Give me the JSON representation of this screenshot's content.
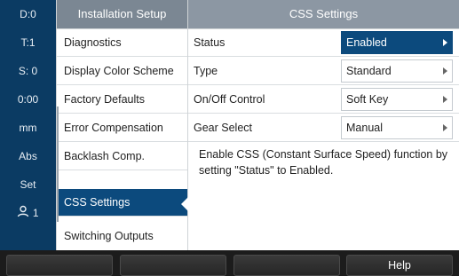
{
  "statusbar": {
    "items": [
      {
        "label": "D:0"
      },
      {
        "label": "T:1"
      },
      {
        "label": "S: 0"
      },
      {
        "label": "0:00"
      },
      {
        "label": "mm"
      },
      {
        "label": "Abs"
      },
      {
        "label": "Set"
      },
      {
        "label": "1",
        "icon": "user-icon"
      }
    ]
  },
  "header": {
    "left_title": "Installation Setup",
    "right_title": "CSS Settings"
  },
  "menu": {
    "items": [
      {
        "label": "Diagnostics"
      },
      {
        "label": "Display Color Scheme"
      },
      {
        "label": "Factory Defaults"
      },
      {
        "label": "Error Compensation"
      },
      {
        "label": "Backlash Comp."
      },
      {
        "label": "CSS Settings",
        "selected": true
      },
      {
        "label": "Switching Outputs"
      }
    ]
  },
  "settings": {
    "rows": [
      {
        "label": "Status",
        "value": "Enabled"
      },
      {
        "label": "Type",
        "value": "Standard"
      },
      {
        "label": "On/Off Control",
        "value": "Soft Key"
      },
      {
        "label": "Gear Select",
        "value": "Manual"
      }
    ],
    "description": "Enable CSS (Constant Surface Speed) function by setting \"Status\" to Enabled."
  },
  "softkeys": {
    "labels": [
      "",
      "",
      "",
      "Help"
    ]
  },
  "colors": {
    "statusbar_bg": "#0b3b63",
    "header_bg": "#8c97a3",
    "selected_bg": "#0c4a7d"
  }
}
